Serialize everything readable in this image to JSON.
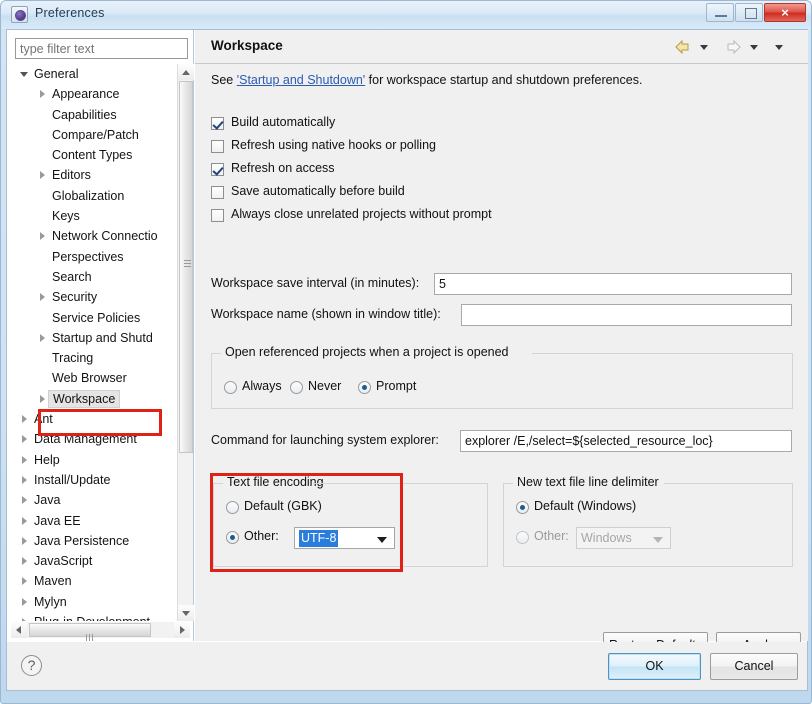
{
  "window": {
    "title": "Preferences",
    "icon": "preferences-icon",
    "minimize_label": "Minimize",
    "maximize_label": "Maximize",
    "close_label": "×"
  },
  "sidebar": {
    "filter_placeholder": "type filter text",
    "filter_value": "",
    "items": [
      {
        "label": "General",
        "level": 0,
        "arrow": "expanded",
        "selected": false
      },
      {
        "label": "Appearance",
        "level": 1,
        "arrow": "collapsed",
        "selected": false
      },
      {
        "label": "Capabilities",
        "level": 1,
        "arrow": "none",
        "selected": false
      },
      {
        "label": "Compare/Patch",
        "level": 1,
        "arrow": "none",
        "selected": false
      },
      {
        "label": "Content Types",
        "level": 1,
        "arrow": "none",
        "selected": false
      },
      {
        "label": "Editors",
        "level": 1,
        "arrow": "collapsed",
        "selected": false
      },
      {
        "label": "Globalization",
        "level": 1,
        "arrow": "none",
        "selected": false
      },
      {
        "label": "Keys",
        "level": 1,
        "arrow": "none",
        "selected": false
      },
      {
        "label": "Network Connectio",
        "level": 1,
        "arrow": "collapsed",
        "selected": false
      },
      {
        "label": "Perspectives",
        "level": 1,
        "arrow": "none",
        "selected": false
      },
      {
        "label": "Search",
        "level": 1,
        "arrow": "none",
        "selected": false
      },
      {
        "label": "Security",
        "level": 1,
        "arrow": "collapsed",
        "selected": false
      },
      {
        "label": "Service Policies",
        "level": 1,
        "arrow": "none",
        "selected": false
      },
      {
        "label": "Startup and Shutd",
        "level": 1,
        "arrow": "collapsed",
        "selected": false
      },
      {
        "label": "Tracing",
        "level": 1,
        "arrow": "none",
        "selected": false
      },
      {
        "label": "Web Browser",
        "level": 1,
        "arrow": "none",
        "selected": false
      },
      {
        "label": "Workspace",
        "level": 1,
        "arrow": "collapsed",
        "selected": true
      },
      {
        "label": "Ant",
        "level": 0,
        "arrow": "collapsed",
        "selected": false
      },
      {
        "label": "Data Management",
        "level": 0,
        "arrow": "collapsed",
        "selected": false
      },
      {
        "label": "Help",
        "level": 0,
        "arrow": "collapsed",
        "selected": false
      },
      {
        "label": "Install/Update",
        "level": 0,
        "arrow": "collapsed",
        "selected": false
      },
      {
        "label": "Java",
        "level": 0,
        "arrow": "collapsed",
        "selected": false
      },
      {
        "label": "Java EE",
        "level": 0,
        "arrow": "collapsed",
        "selected": false
      },
      {
        "label": "Java Persistence",
        "level": 0,
        "arrow": "collapsed",
        "selected": false
      },
      {
        "label": "JavaScript",
        "level": 0,
        "arrow": "collapsed",
        "selected": false
      },
      {
        "label": "Maven",
        "level": 0,
        "arrow": "collapsed",
        "selected": false
      },
      {
        "label": "Mylyn",
        "level": 0,
        "arrow": "collapsed",
        "selected": false
      },
      {
        "label": "Plug-in Development",
        "level": 0,
        "arrow": "collapsed",
        "selected": false
      }
    ]
  },
  "page": {
    "title": "Workspace",
    "description_prefix": "See ",
    "description_link": "'Startup and Shutdown'",
    "description_suffix": " for workspace startup and shutdown preferences.",
    "nav": {
      "back_icon": "back-arrow-icon",
      "forward_icon": "forward-arrow-icon",
      "menu_icon": "chevron-down-icon"
    },
    "checkboxes": [
      {
        "label": "Build automatically",
        "checked": true
      },
      {
        "label": "Refresh using native hooks or polling",
        "checked": false
      },
      {
        "label": "Refresh on access",
        "checked": true
      },
      {
        "label": "Save automatically before build",
        "checked": false
      },
      {
        "label": "Always close unrelated projects without prompt",
        "checked": false
      }
    ],
    "save_interval": {
      "label": "Workspace save interval (in minutes):",
      "value": "5"
    },
    "workspace_name": {
      "label": "Workspace name (shown in window title):",
      "value": ""
    },
    "open_referenced": {
      "title": "Open referenced projects when a project is opened",
      "options": [
        {
          "label": "Always",
          "selected": false
        },
        {
          "label": "Never",
          "selected": false
        },
        {
          "label": "Prompt",
          "selected": true
        }
      ]
    },
    "command_explorer": {
      "label": "Command for launching system explorer:",
      "value": "explorer /E,/select=${selected_resource_loc}"
    },
    "text_file_encoding": {
      "title": "Text file encoding",
      "default_label": "Default (GBK)",
      "default_selected": false,
      "other_label": "Other:",
      "other_selected": true,
      "other_value": "UTF-8"
    },
    "line_delimiter": {
      "title": "New text file line delimiter",
      "default_label": "Default (Windows)",
      "default_selected": true,
      "other_label": "Other:",
      "other_selected": false,
      "other_value": "Windows"
    },
    "restore_defaults_label": "Restore Defaults",
    "apply_label": "Apply"
  },
  "footer": {
    "help_icon": "help-question-icon",
    "ok_label": "OK",
    "cancel_label": "Cancel"
  },
  "annotations": {
    "highlight_color": "#e02216",
    "boxes": [
      "workspace-tree-item",
      "text-file-encoding-group"
    ]
  }
}
